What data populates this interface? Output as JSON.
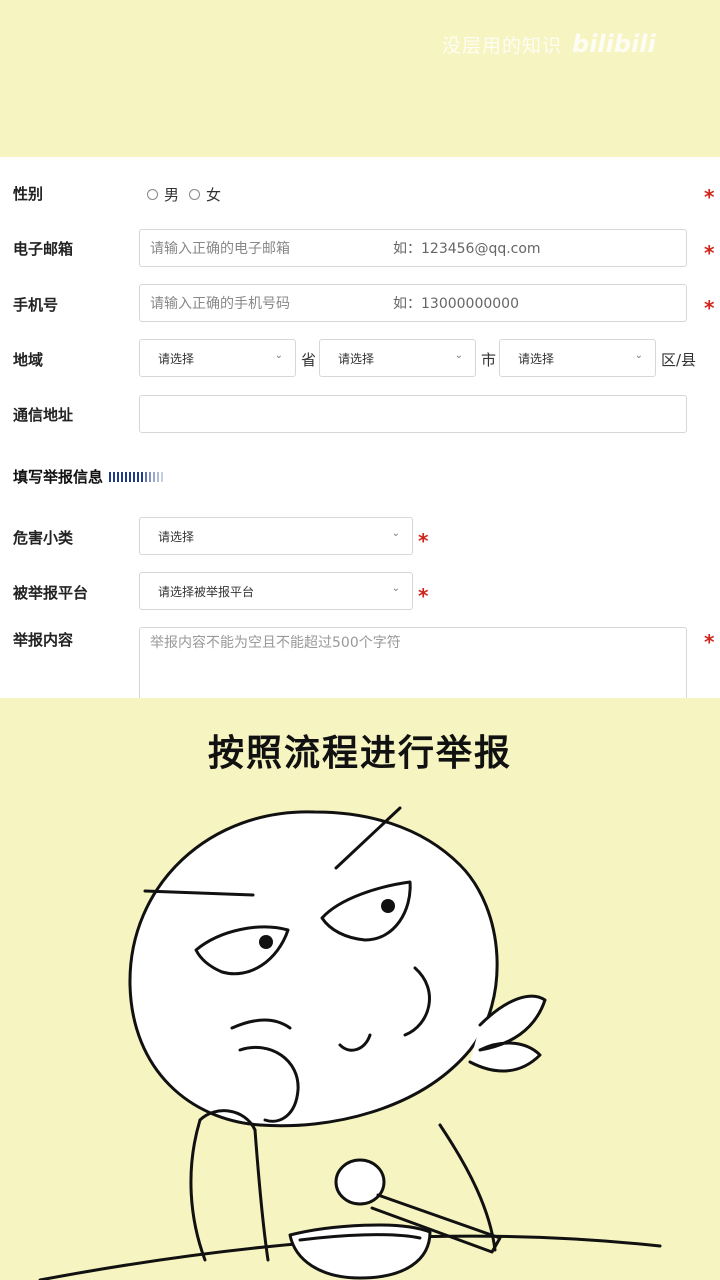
{
  "watermark": {
    "text": "没层用的知识",
    "logo": "bilibili"
  },
  "form": {
    "gender": {
      "label": "性别",
      "options": [
        "男",
        "女"
      ]
    },
    "email": {
      "label": "电子邮箱",
      "placeholder": "请输入正确的电子邮箱",
      "example": "如：123456@qq.com"
    },
    "phone": {
      "label": "手机号",
      "placeholder": "请输入正确的手机号码",
      "example": "如：13000000000"
    },
    "region": {
      "label": "地域",
      "province": {
        "value": "请选择",
        "unit": "省"
      },
      "city": {
        "value": "请选择",
        "unit": "市"
      },
      "county": {
        "value": "请选择",
        "unit": "区/县"
      }
    },
    "address": {
      "label": "通信地址",
      "value": ""
    },
    "section_title": "填写举报信息",
    "category": {
      "label": "危害小类",
      "value": "请选择"
    },
    "platform": {
      "label": "被举报平台",
      "value": "请选择被举报平台"
    },
    "content": {
      "label": "举报内容",
      "placeholder": "举报内容不能为空且不能超过500个字符"
    },
    "required_mark": "*"
  },
  "caption": "按照流程进行举报",
  "colors": {
    "background": "#f6f4c0",
    "required": "#d0241b",
    "accent": "#1f3c88"
  }
}
